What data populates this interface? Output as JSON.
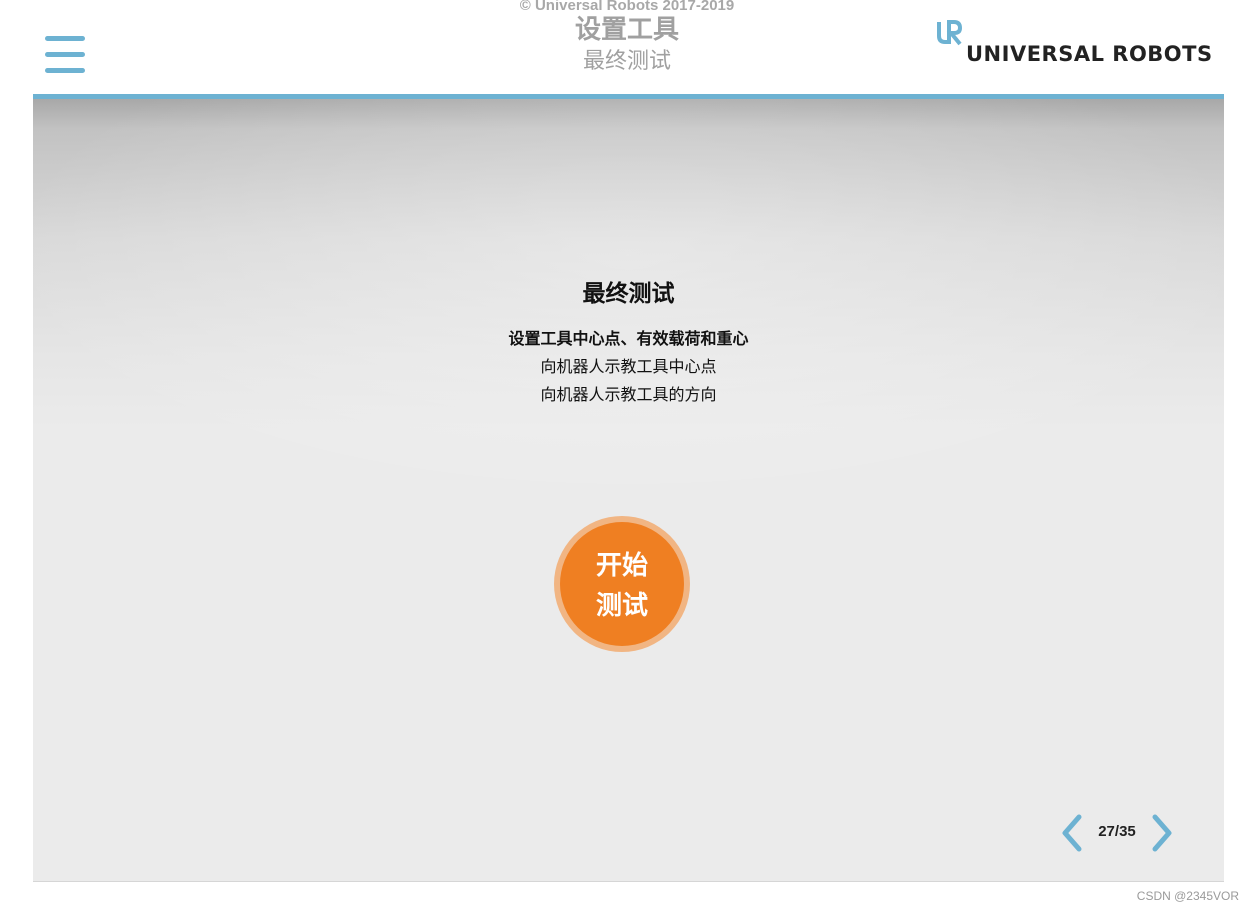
{
  "copyright": "© Universal Robots 2017-2019",
  "header": {
    "title": "设置工具",
    "subtitle": "最终测试",
    "menu_icon": "hamburger-menu-icon",
    "logo_text": "UNIVERSAL ROBOTS",
    "logo_mark": "UR"
  },
  "main": {
    "title": "最终测试",
    "lines": [
      "设置工具中心点、有效载荷和重心",
      "向机器人示教工具中心点",
      "向机器人示教工具的方向"
    ],
    "start_button": {
      "line1": "开始",
      "line2": "测试"
    }
  },
  "pager": {
    "text": "27/35",
    "current": 27,
    "total": 35,
    "prev_icon": "chevron-left-icon",
    "next_icon": "chevron-right-icon"
  },
  "watermark": "CSDN @2345VOR",
  "colors": {
    "accent": "#6db2d2",
    "button": "#ef7f22",
    "button_ring": "#f1b583",
    "header_text": "#a0a0a0"
  }
}
